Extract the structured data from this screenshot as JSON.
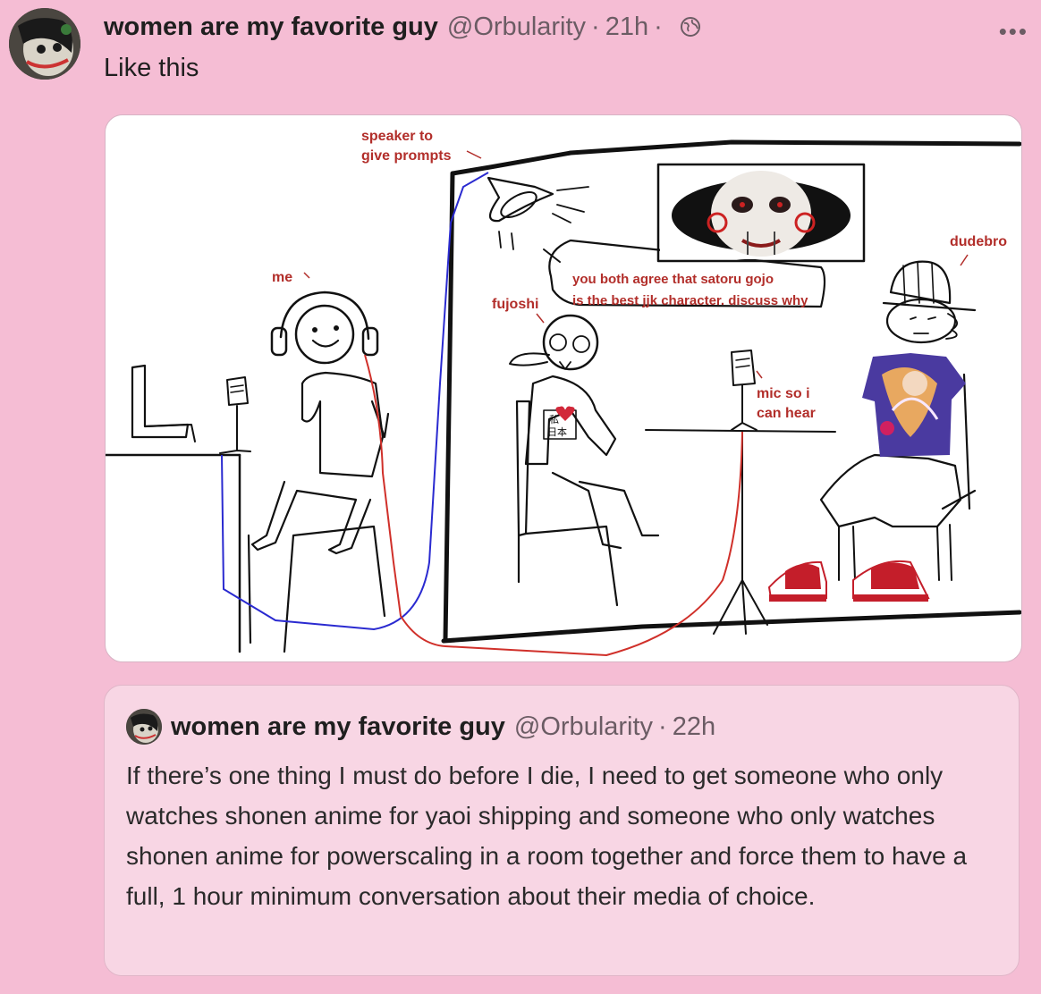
{
  "post": {
    "display_name": "women are my favorite guy",
    "handle": "@Orbularity",
    "time": "21h",
    "separator": "·",
    "text": "Like this",
    "more_label": "•••"
  },
  "image": {
    "labels": {
      "speaker_1": "speaker to",
      "speaker_2": "give prompts",
      "me": "me",
      "fujoshi": "fujoshi",
      "dudebro": "dudebro",
      "prompt_1": "you both agree that satoru gojo",
      "prompt_2": "is the best jjk character. discuss why",
      "mic_1": "mic so i",
      "mic_2": "can hear",
      "shirt_1": "私",
      "shirt_2": "日本"
    }
  },
  "quote": {
    "display_name": "women are my favorite guy",
    "handle": "@Orbularity",
    "time": "22h",
    "separator": "·",
    "text": "If there’s one thing I must do before I die, I need to get someone who only watches shonen anime for yaoi shipping and someone who only watches shonen anime for powerscaling in a room together and force them to have a full, 1 hour minimum conversation about their media of choice."
  }
}
